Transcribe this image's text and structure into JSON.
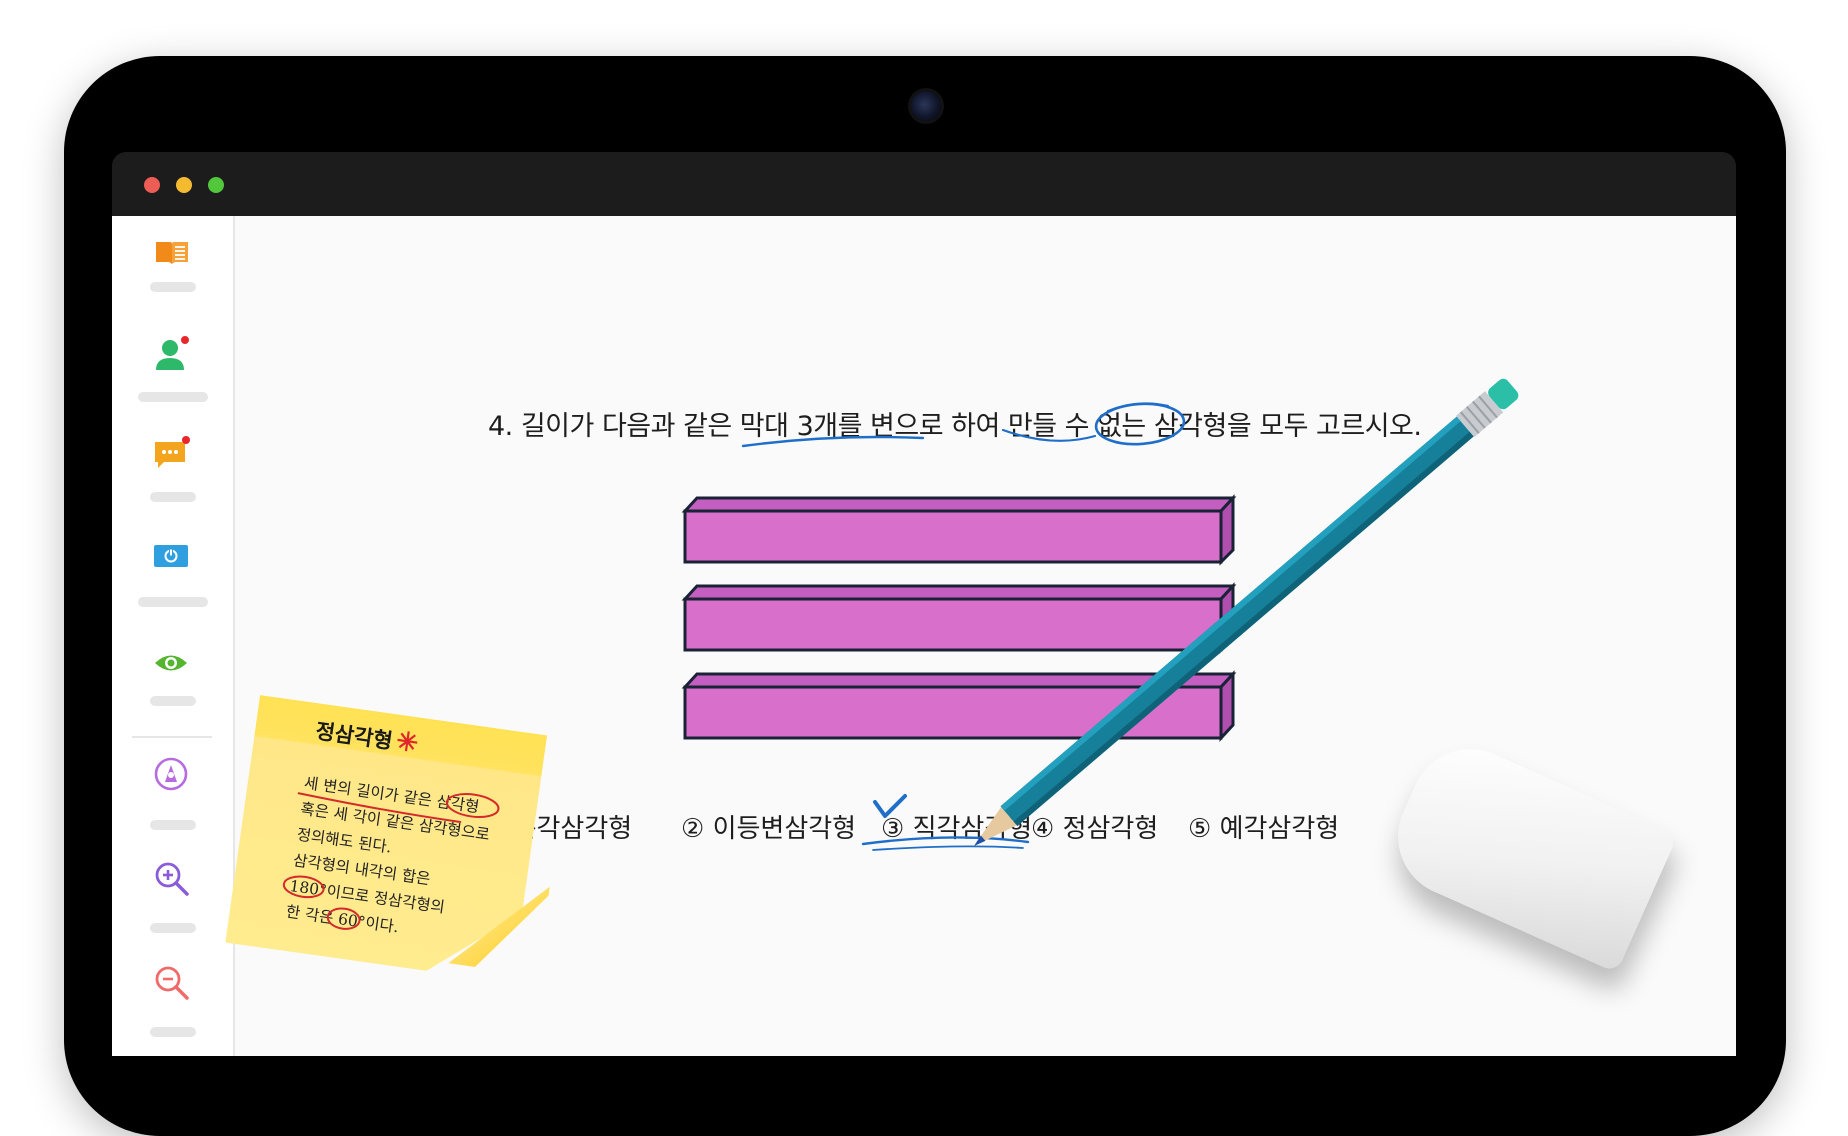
{
  "window": {
    "buttons": [
      "close",
      "minimize",
      "maximize"
    ]
  },
  "sidebar": {
    "items": [
      {
        "icon": "book-icon",
        "color": "#f28a1a"
      },
      {
        "icon": "user-icon",
        "color": "#2db86a",
        "notification": true
      },
      {
        "icon": "chat-icon",
        "color": "#f4a51e",
        "notification": true
      },
      {
        "icon": "power-screen-icon",
        "color": "#2f9fe0"
      },
      {
        "icon": "eye-icon",
        "color": "#56b530"
      },
      {
        "icon": "pen-circle-icon",
        "color": "#b76be0"
      },
      {
        "icon": "zoom-in-icon",
        "color": "#8a5cd8"
      },
      {
        "icon": "zoom-out-icon",
        "color": "#f06a6a"
      }
    ]
  },
  "question": {
    "text": "4. 길이가 다음과 같은 막대 3개를 변으로 하여 만들 수 없는 삼각형을 모두 고르시오."
  },
  "sticks": {
    "count": 3,
    "color": "#d86fcb"
  },
  "options": [
    {
      "label": "① 둔각삼각형"
    },
    {
      "label": "② 이등변삼각형"
    },
    {
      "label": "③ 직각삼각형",
      "checked": true
    },
    {
      "label": "④ 정삼각형"
    },
    {
      "label": "⑤ 예각삼각형"
    }
  ],
  "sticky_note": {
    "title": "정삼각형",
    "lines": [
      "세 변의 길이가 같은 삼각형",
      "혹은 세 각이 같은 삼각형으로",
      "정의해도 된다.",
      "삼각형의 내각의 합은",
      "180°이므로 정삼각형의",
      "한 각은 60°이다."
    ]
  },
  "annotation_color": "#1f6fc8"
}
